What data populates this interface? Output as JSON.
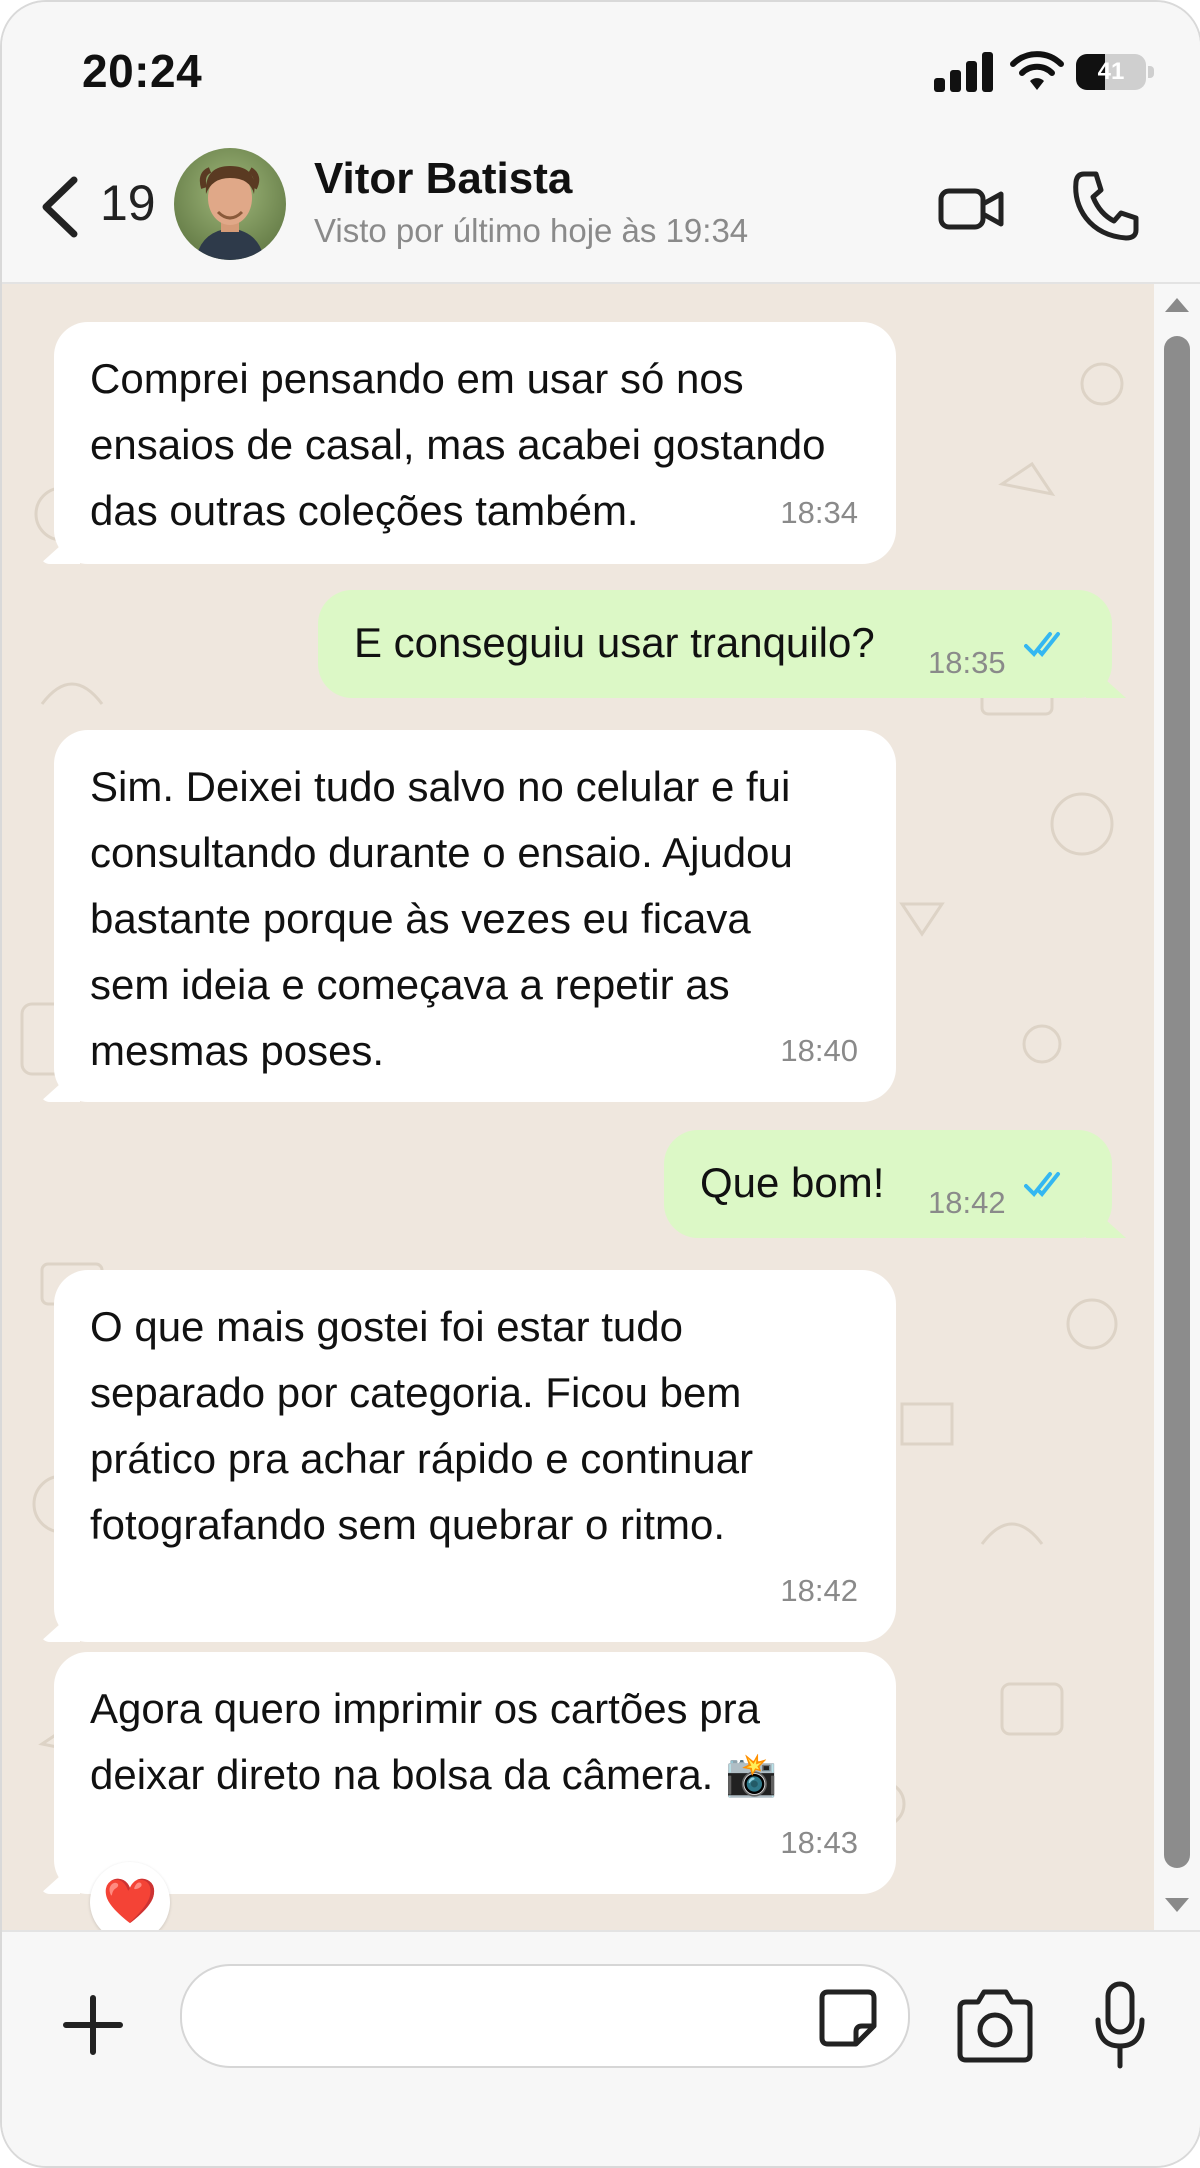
{
  "status_bar": {
    "time": "20:24",
    "battery_level": "41"
  },
  "header": {
    "back_count": "19",
    "contact_name": "Vitor Batista",
    "last_seen": "Visto por último hoje às 19:34",
    "avatar_icon": "person-avatar",
    "video_icon": "video-camera-icon",
    "call_icon": "phone-icon"
  },
  "colors": {
    "chat_background": "#efe7de",
    "incoming_bubble": "#ffffff",
    "outgoing_bubble": "#dcf8c6",
    "read_ticks": "#34b7f1"
  },
  "messages": [
    {
      "direction": "in",
      "text": "Comprei pensando em usar só nos\nensaios de casal, mas acabei gostando\ndas outras coleções também.",
      "time": "18:34"
    },
    {
      "direction": "out",
      "text": "E conseguiu usar tranquilo?",
      "time": "18:35",
      "status": "read"
    },
    {
      "direction": "in",
      "text": "Sim. Deixei tudo salvo no celular e fui\nconsultando durante o ensaio. Ajudou\nbastante porque às vezes eu ficava\nsem ideia e começava a repetir as\nmesmas poses.",
      "time": "18:40"
    },
    {
      "direction": "out",
      "text": "Que bom!",
      "time": "18:42",
      "status": "read"
    },
    {
      "direction": "in",
      "text": "O que mais gostei foi estar tudo\nseparado por categoria. Ficou bem\nprático pra achar rápido e continuar\nfotografando sem quebrar o ritmo.",
      "time": "18:42"
    },
    {
      "direction": "in",
      "text": "Agora quero imprimir os cartões pra\ndeixar direto na bolsa da câmera. 📸",
      "time": "18:43",
      "reaction": "❤️"
    }
  ],
  "input_bar": {
    "placeholder": "",
    "plus_icon": "plus-icon",
    "sticker_icon": "sticker-icon",
    "camera_icon": "camera-icon",
    "mic_icon": "microphone-icon"
  }
}
